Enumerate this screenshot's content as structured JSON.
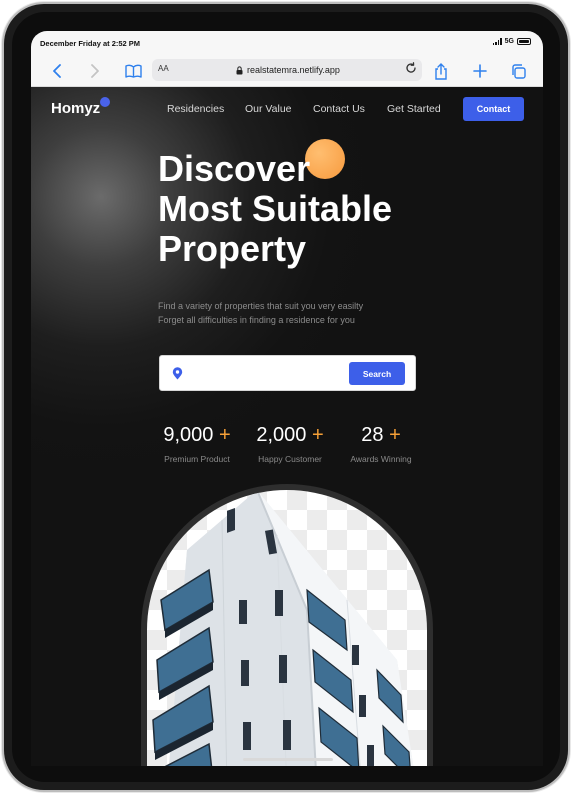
{
  "status_bar": {
    "time": "December Friday at 2:52 PM",
    "network": "5G"
  },
  "browser": {
    "text_size_label": "AA",
    "url": "realstatemra.netlify.app",
    "icons": [
      "back-icon",
      "forward-icon",
      "bookmarks-icon",
      "lock-icon",
      "reload-icon",
      "share-icon",
      "new-tab-icon",
      "tabs-icon"
    ]
  },
  "header": {
    "logo": "Homyz",
    "nav": [
      "Residencies",
      "Our Value",
      "Contact Us",
      "Get Started"
    ],
    "contact_button": "Contact"
  },
  "hero": {
    "title_lines": [
      "Discover",
      "Most Suitable",
      "Property"
    ],
    "subtitle_lines": [
      "Find a variety of properties that suit you very easilty",
      "Forget all difficulties in finding a residence for you"
    ],
    "search_placeholder": "",
    "search_button": "Search"
  },
  "stats": [
    {
      "value": "9,000",
      "plus": "+",
      "label": "Premium Product"
    },
    {
      "value": "2,000",
      "plus": "+",
      "label": "Happy Customer"
    },
    {
      "value": "28",
      "plus": "+",
      "label": "Awards Winning"
    }
  ],
  "colors": {
    "accent_blue": "#3d5fe9",
    "accent_orange": "#f6a037",
    "background": "#121212"
  }
}
